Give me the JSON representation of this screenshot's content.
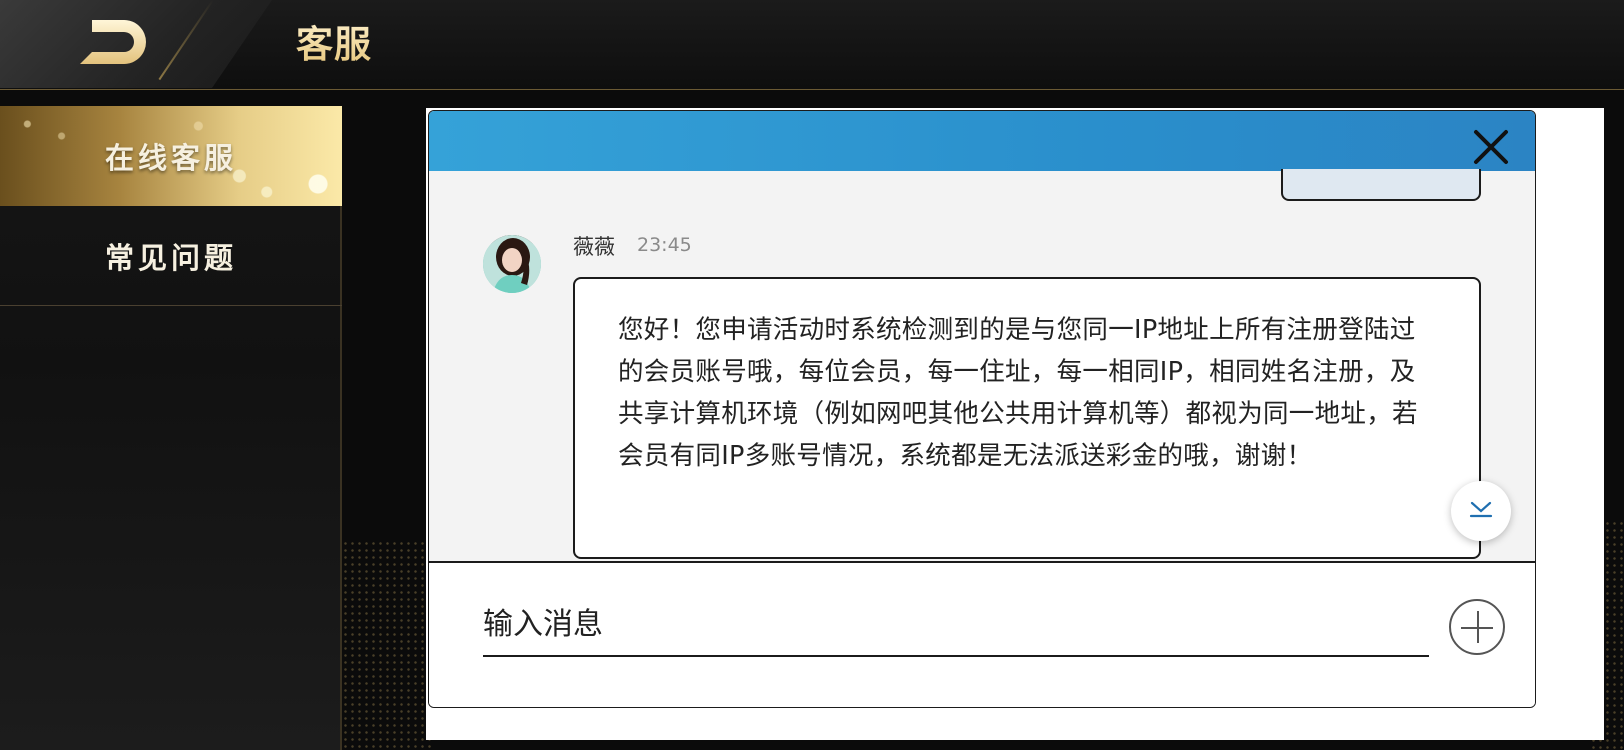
{
  "header": {
    "title": "客服",
    "back_icon": "back-arrow-icon"
  },
  "sidebar": {
    "items": [
      {
        "label": "在线客服",
        "active": true
      },
      {
        "label": "常见问题",
        "active": false
      }
    ]
  },
  "chat": {
    "header_color": "#2f96d0",
    "close_icon": "close-icon",
    "message": {
      "sender": "薇薇",
      "time": "23:45",
      "text": "您好！您申请活动时系统检测到的是与您同一IP地址上所有注册登陆过的会员账号哦，每位会员，每一住址，每一相同IP，相同姓名注册，及共享计算机环境（例如网吧其他公共用计算机等）都视为同一地址，若会员有同IP多账号情况，系统都是无法派送彩金的哦，谢谢！"
    },
    "input": {
      "placeholder": "输入消息"
    },
    "attach_icon": "plus-icon",
    "scroll_icon": "chevron-down-icon"
  }
}
